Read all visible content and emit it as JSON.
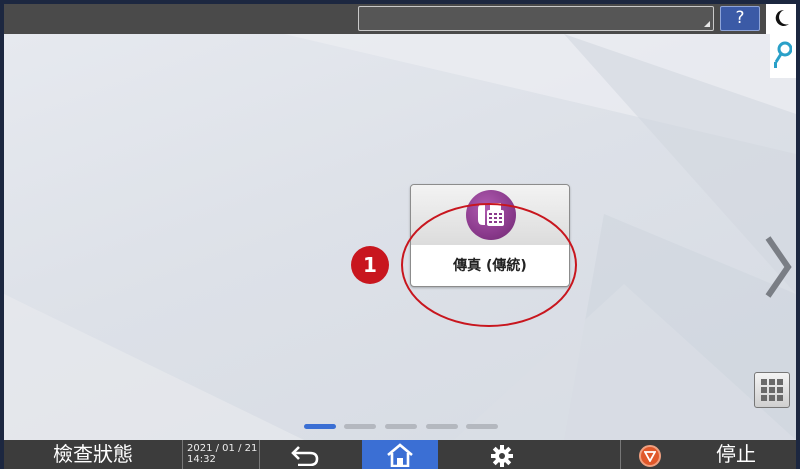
{
  "topbar": {
    "help_label": "?",
    "icons": [
      "moon-icon",
      "search-icon"
    ]
  },
  "main": {
    "callout_number": "1",
    "tiles": [
      {
        "label": "傳真 (傳統)",
        "icon": "fax-icon",
        "accent": "#8a3a8c"
      }
    ],
    "pages": {
      "count": 5,
      "active": 0
    }
  },
  "bottombar": {
    "status_label": "檢查狀態",
    "date": "2021 / 01 / 21",
    "time": "14:32",
    "stop_label": "停止",
    "home_color": "#3b6fd4",
    "icons": [
      "back-icon",
      "home-icon",
      "settings-icon",
      "stop-icon"
    ]
  },
  "colors": {
    "callout": "#c8161e",
    "active_page": "#3b6fd4"
  }
}
